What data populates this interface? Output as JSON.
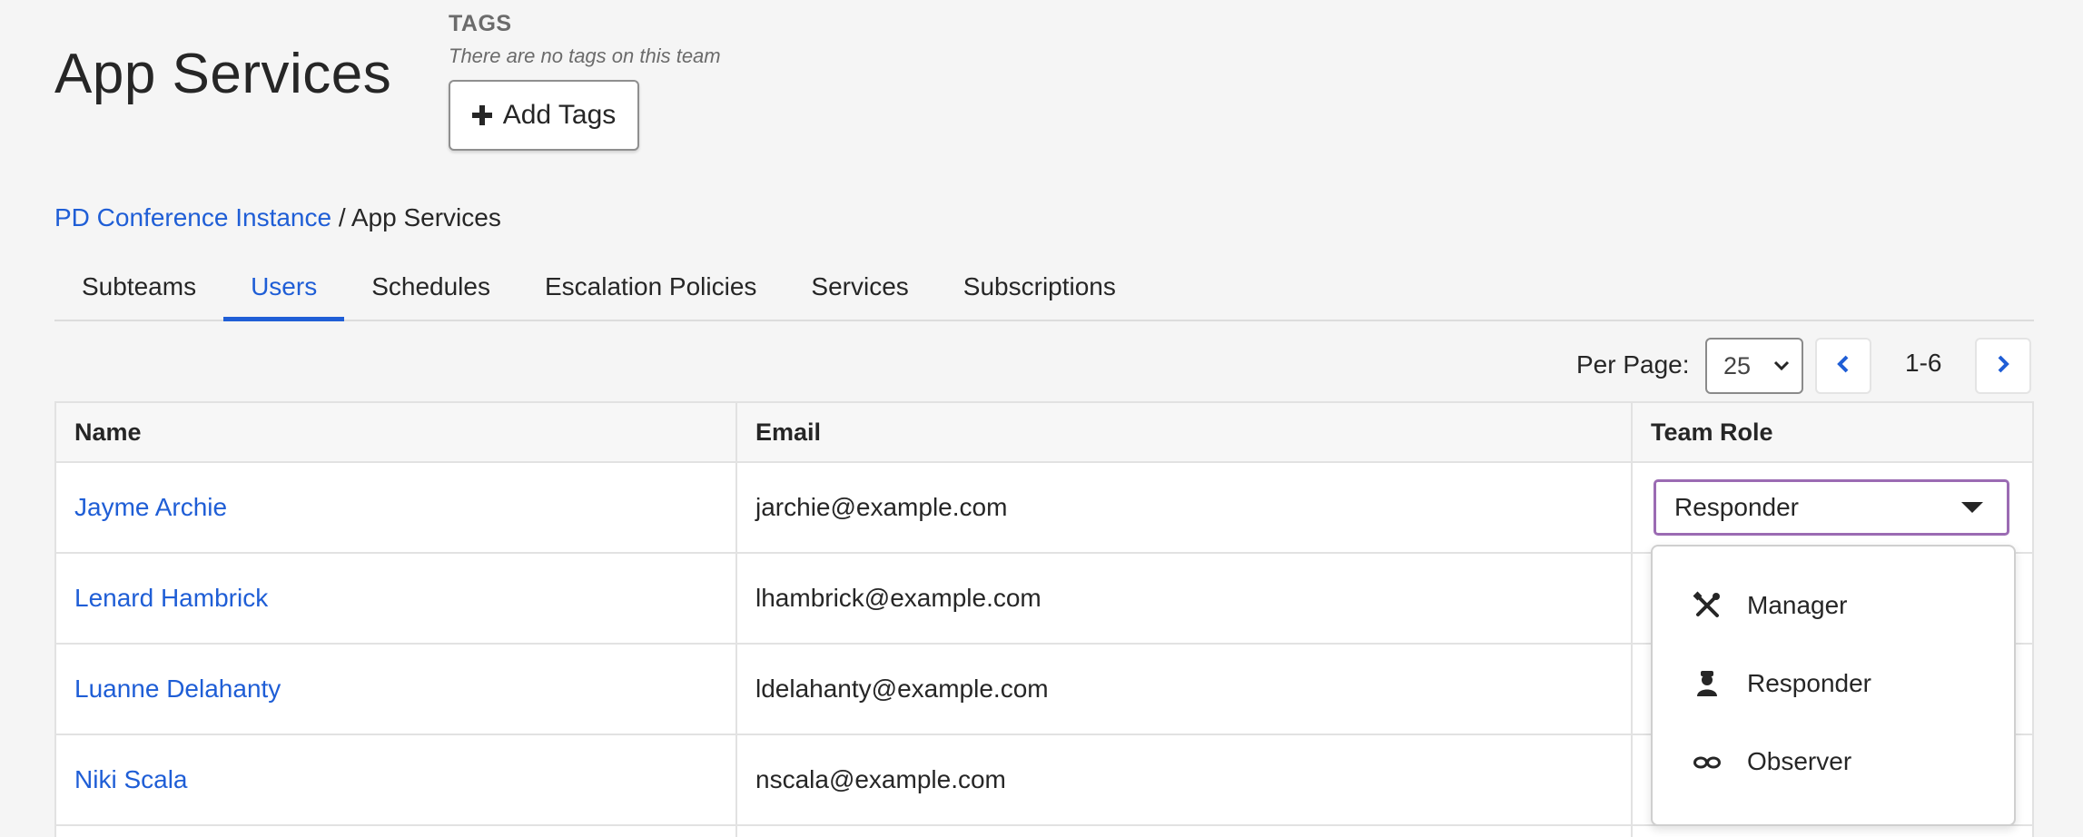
{
  "team": {
    "title": "App Services",
    "tags_heading": "TAGS",
    "tags_empty": "There are no tags on this team",
    "add_tags_label": "Add Tags"
  },
  "breadcrumb": {
    "parent": "PD Conference Instance",
    "separator": "/",
    "current": "App Services"
  },
  "tabs": [
    {
      "label": "Subteams",
      "active": false
    },
    {
      "label": "Users",
      "active": true
    },
    {
      "label": "Schedules",
      "active": false
    },
    {
      "label": "Escalation Policies",
      "active": false
    },
    {
      "label": "Services",
      "active": false
    },
    {
      "label": "Subscriptions",
      "active": false
    }
  ],
  "pagination": {
    "per_page_label": "Per Page:",
    "per_page_value": "25",
    "range": "1-6"
  },
  "table": {
    "headers": {
      "name": "Name",
      "email": "Email",
      "role": "Team Role"
    },
    "rows": [
      {
        "name": "Jayme Archie",
        "email": "jarchie@example.com",
        "role": "Responder"
      },
      {
        "name": "Lenard Hambrick",
        "email": "lhambrick@example.com"
      },
      {
        "name": "Luanne Delahanty",
        "email": "ldelahanty@example.com"
      },
      {
        "name": "Niki Scala",
        "email": "nscala@example.com"
      }
    ]
  },
  "role_menu": {
    "options": [
      {
        "label": "Manager",
        "icon": "tools-icon"
      },
      {
        "label": "Responder",
        "icon": "responder-person-icon"
      },
      {
        "label": "Observer",
        "icon": "glasses-icon"
      }
    ]
  },
  "colors": {
    "link": "#1f5ed6",
    "focus_border": "#9b6bb3",
    "background": "#f5f5f5"
  }
}
